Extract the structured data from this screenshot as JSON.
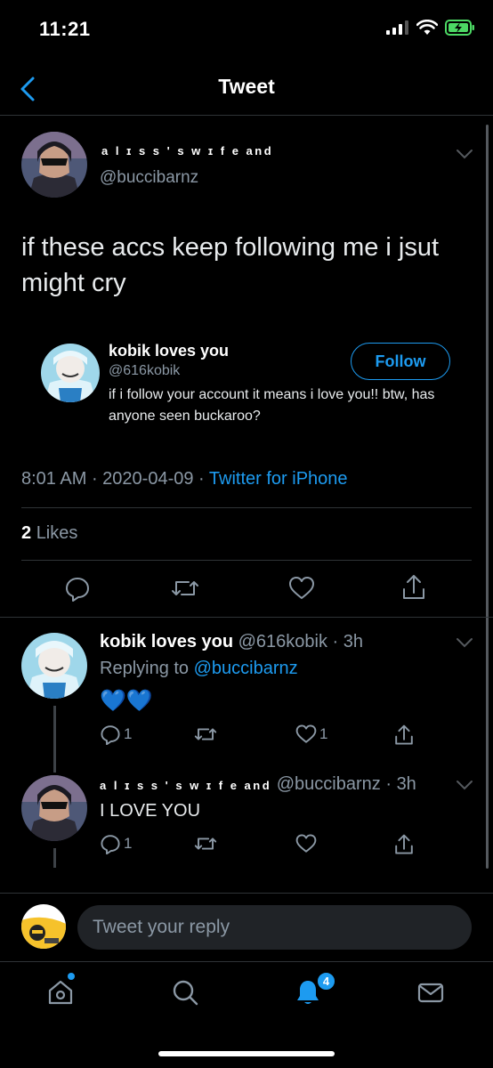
{
  "status_bar": {
    "time": "11:21"
  },
  "nav": {
    "title": "Tweet"
  },
  "tweet": {
    "author_name": "a l ɪ s s ' s  w ɪ f e  and",
    "author_handle": "@buccibarnz",
    "text": "if these accs keep following me i jsut might cry",
    "quote": {
      "name": "kobik loves you",
      "handle": "@616kobik",
      "follow_label": "Follow",
      "bio": "if i follow your account it means i love you!! btw, has anyone seen buckaroo?"
    },
    "time": "8:01 AM",
    "date": "2020-04-09",
    "source": "Twitter for iPhone",
    "likes_count": "2",
    "likes_label": "Likes"
  },
  "replies": [
    {
      "name": "kobik loves you",
      "handle": "@616kobik",
      "age": "3h",
      "replying_prefix": "Replying to",
      "replying_to": "@buccibarnz",
      "text": "💙💙",
      "reply_count": "1",
      "like_count": "1"
    },
    {
      "name": "a l ɪ s s ' s  w ɪ f e  and",
      "handle": "@buccibarnz",
      "age": "3h",
      "text": "I LOVE YOU",
      "reply_count": "1"
    }
  ],
  "compose": {
    "placeholder": "Tweet your reply"
  },
  "tabbar": {
    "notifications_badge": "4"
  },
  "colors": {
    "accent": "#1d9bf0",
    "background": "#000000",
    "secondary_text": "#8b98a5",
    "divider": "#2f3336",
    "battery": "#4cd964"
  },
  "icons": [
    "signal-icon",
    "wifi-icon",
    "battery-icon",
    "back-chevron-icon",
    "chevron-down-icon",
    "reply-icon",
    "retweet-icon",
    "like-icon",
    "share-icon",
    "home-icon",
    "search-icon",
    "notifications-icon",
    "messages-icon"
  ]
}
